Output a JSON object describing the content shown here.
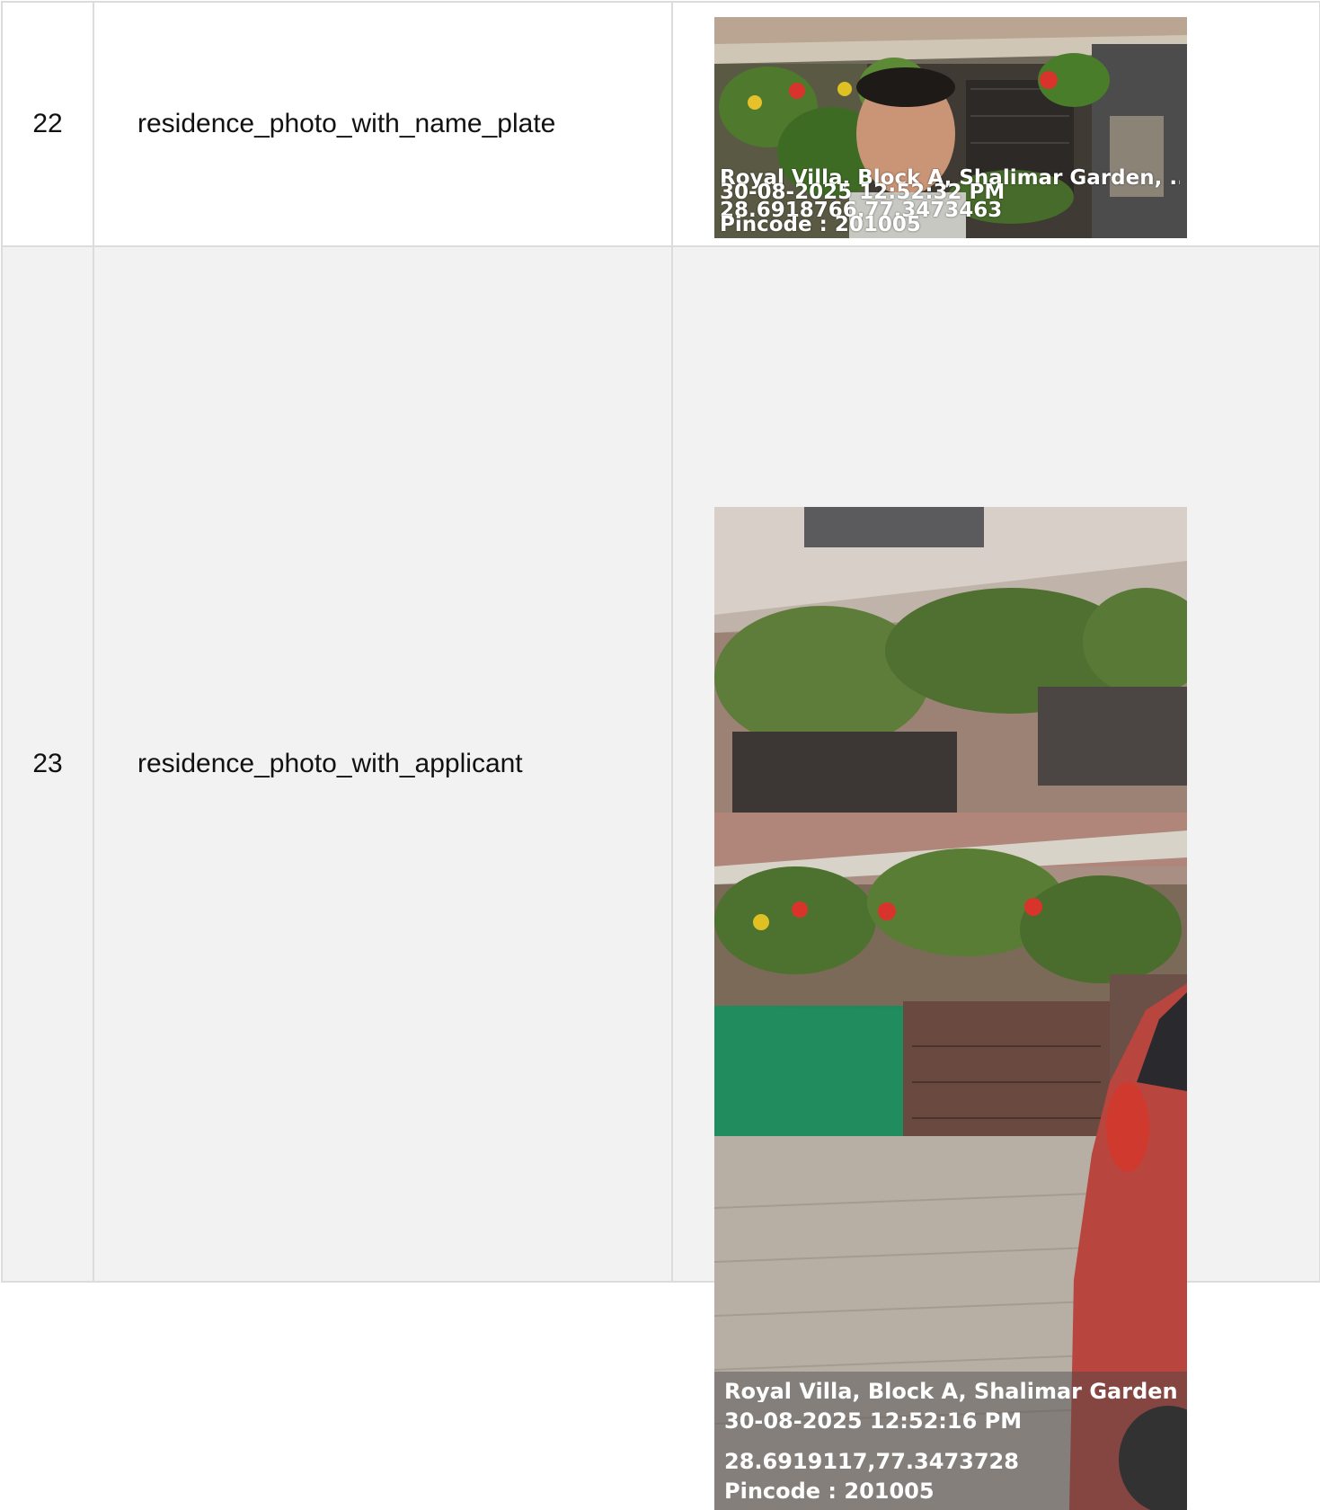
{
  "rows": [
    {
      "number": "22",
      "label": "residence_photo_with_name_plate",
      "photo": {
        "address": "Royal Villa, Block A, Shalimar Garden, ...",
        "datetime": "30-08-2025 12:52:32 PM",
        "coordinates": "28.6918766,77.3473463",
        "pincode": "Pincode : 201005"
      }
    },
    {
      "number": "23",
      "label": "residence_photo_with_applicant",
      "photo": {
        "address": "Royal Villa, Block A, Shalimar Garden, ...",
        "datetime": "30-08-2025 12:52:16 PM",
        "coordinates": "28.6919117,77.3473728",
        "pincode": "Pincode : 201005"
      }
    }
  ]
}
